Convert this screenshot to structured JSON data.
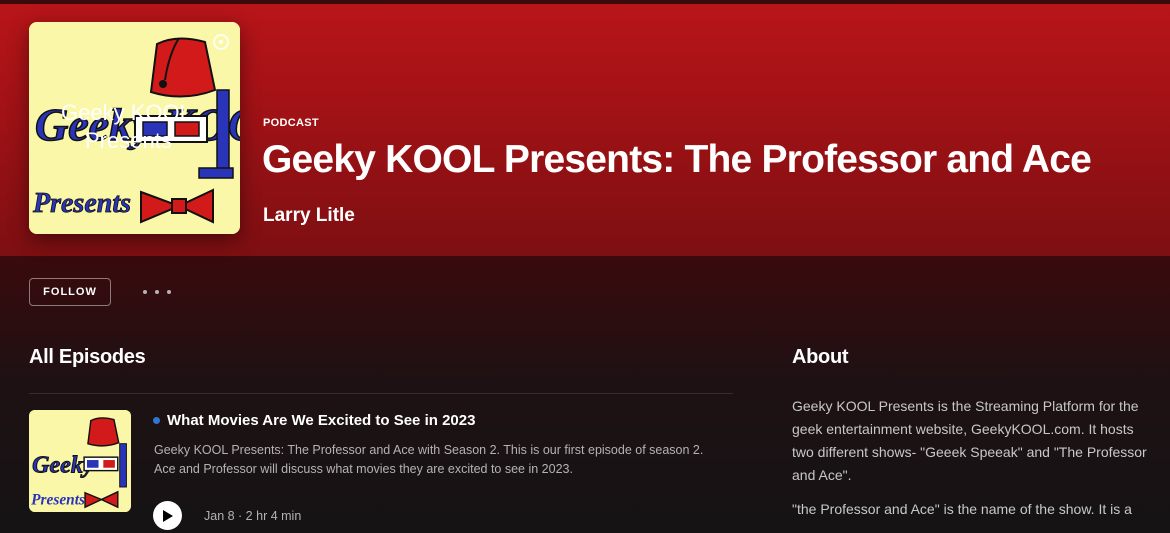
{
  "header": {
    "type_label": "PODCAST",
    "title": "Geeky KOOL Presents: The Professor and Ace",
    "author": "Larry Litle",
    "cover_art": {
      "logo_text": "Geeky KOOL",
      "logo_subtext": "Presents",
      "overlay_text_line1": "Geeky KOOL",
      "overlay_text_line2": "Presents",
      "icons": [
        "fez-hat-icon",
        "3d-glasses-icon",
        "bow-tie-icon",
        "podcast-badge-icon"
      ]
    }
  },
  "actions": {
    "follow_label": "FOLLOW",
    "more_icon": "more-options-icon"
  },
  "episodes": {
    "heading": "All Episodes",
    "items": [
      {
        "title": "What Movies Are We Excited to See in 2023",
        "description": "Geeky KOOL Presents: The Professor and Ace with Season 2.  This is our first episode of season 2.  Ace and Professor will discuss what movies they are excited to see in 2023.",
        "meta": "Jan 8 · 2 hr 4 min",
        "is_new": true,
        "play_icon": "play-icon"
      }
    ]
  },
  "about": {
    "heading": "About",
    "paragraphs": [
      "Geeky KOOL Presents is the Streaming Platform for the geek entertainment website, GeekyKOOL.com. It hosts two different shows- \"Geeek Speeak\" and \"The Professor and Ace\".",
      "\"the Professor and Ace\" is the name of the show. It is a"
    ]
  },
  "colors": {
    "hero_red": "#b81519",
    "page_bg": "#121212",
    "new_dot_blue": "#2e77d0",
    "cover_yellow": "#fbf7a9"
  }
}
